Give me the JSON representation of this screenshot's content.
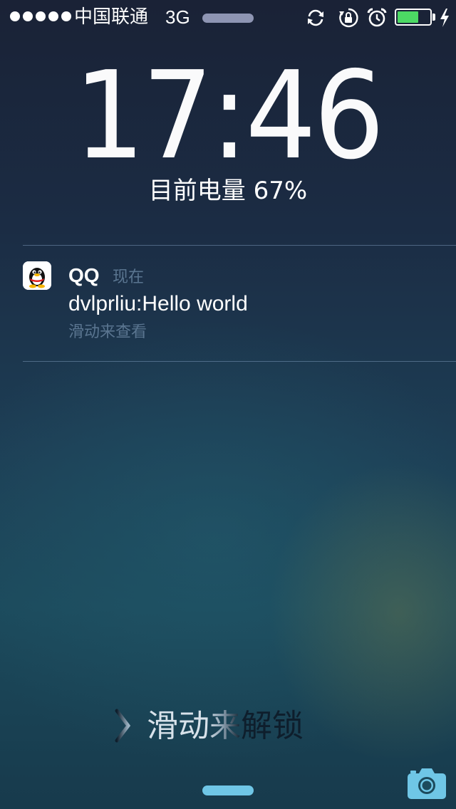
{
  "status_bar": {
    "carrier": "中国联通",
    "network": "3G",
    "battery_level": 0.67,
    "icons": [
      "signal-dots",
      "activity-indicator",
      "sync-icon",
      "rotation-lock-icon",
      "alarm-icon",
      "battery-icon",
      "charging-bolt-icon"
    ]
  },
  "lockscreen": {
    "time": "17:46",
    "battery_text": "目前电量 67%"
  },
  "notification": {
    "app_name": "QQ",
    "time": "现在",
    "message": "dvlprliu:Hello world",
    "hint": "滑动来查看",
    "icon": "qq-penguin-icon"
  },
  "unlock": {
    "label": "滑动来解锁",
    "icon": "chevron-right-icon"
  },
  "bottom": {
    "icons": [
      "control-center-grabber",
      "camera-icon"
    ]
  },
  "colors": {
    "battery_fill": "#4cd964",
    "hint_text": "#5a7590",
    "grabber": "#6fc6e6",
    "camera": "#6fc6e6"
  }
}
